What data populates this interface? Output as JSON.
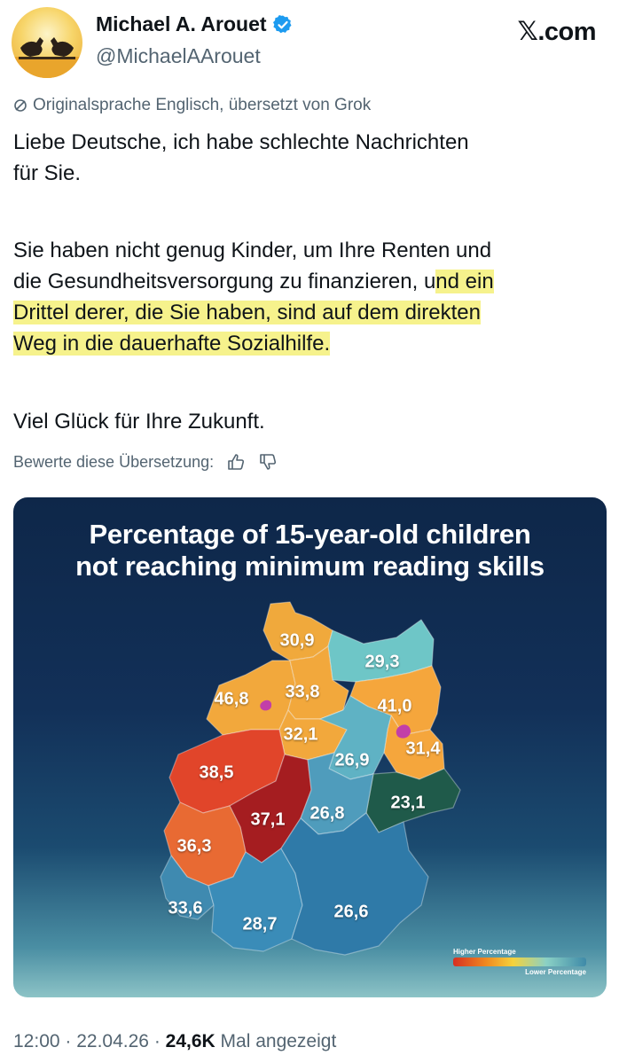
{
  "author": {
    "name": "Michael A. Arouet",
    "handle": "@MichaelAArouet",
    "verified_color": "#1d9bf0"
  },
  "brand": {
    "x_glyph": "𝕏",
    "domain": ".com"
  },
  "translation_note": "Originalsprache Englisch, übersetzt von Grok",
  "tweet": {
    "p1_line1": "Liebe Deutsche, ich habe schlechte Nachrichten",
    "p1_line2": "für Sie.",
    "p2_line1": "Sie haben nicht genug Kinder, um Ihre Renten und",
    "p2_line2_a": "die Gesundheitsversorgung zu finanzieren, u",
    "p2_line2_b": "nd ein",
    "p2_line3": "Drittel derer, die Sie haben, sind auf dem direkten",
    "p2_line4": "Weg in die dauerhafte Sozialhilfe.",
    "p3": "Viel Glück für Ihre Zukunft.",
    "highlight_color": "#f6f28c"
  },
  "rate_translation": "Bewerte diese Übersetzung:",
  "map": {
    "title_line1": "Percentage of 15-year-old children",
    "title_line2": "not reaching minimum reading skills",
    "legend_high": "Higher Percentage",
    "legend_low": "Lower Percentage",
    "states": [
      {
        "value": "30,9",
        "color": "#f0a93c"
      },
      {
        "value": "29,3",
        "color": "#6ec6c7"
      },
      {
        "value": "46,8",
        "color": "#f2a83c"
      },
      {
        "value": "33,8",
        "color": "#f2a83c"
      },
      {
        "value": "41,0",
        "color": "#f5a63c"
      },
      {
        "value": "32,1",
        "color": "#f2a83c"
      },
      {
        "value": "31,4",
        "color": "#f5a63c"
      },
      {
        "value": "26,9",
        "color": "#5fb2c4"
      },
      {
        "value": "38,5",
        "color": "#e1452a"
      },
      {
        "value": "23,1",
        "color": "#1f5a4a"
      },
      {
        "value": "37,1",
        "color": "#a51d20"
      },
      {
        "value": "26,8",
        "color": "#4f9cbc"
      },
      {
        "value": "36,3",
        "color": "#e86a33"
      },
      {
        "value": "33,6",
        "color": "#3f8ab0"
      },
      {
        "value": "28,7",
        "color": "#3a8cb8"
      },
      {
        "value": "26,6",
        "color": "#2f7aa8"
      }
    ]
  },
  "footer": {
    "time": "12:00",
    "date": "22.04.26",
    "views": "24,6K",
    "views_label": "Mal angezeigt"
  }
}
